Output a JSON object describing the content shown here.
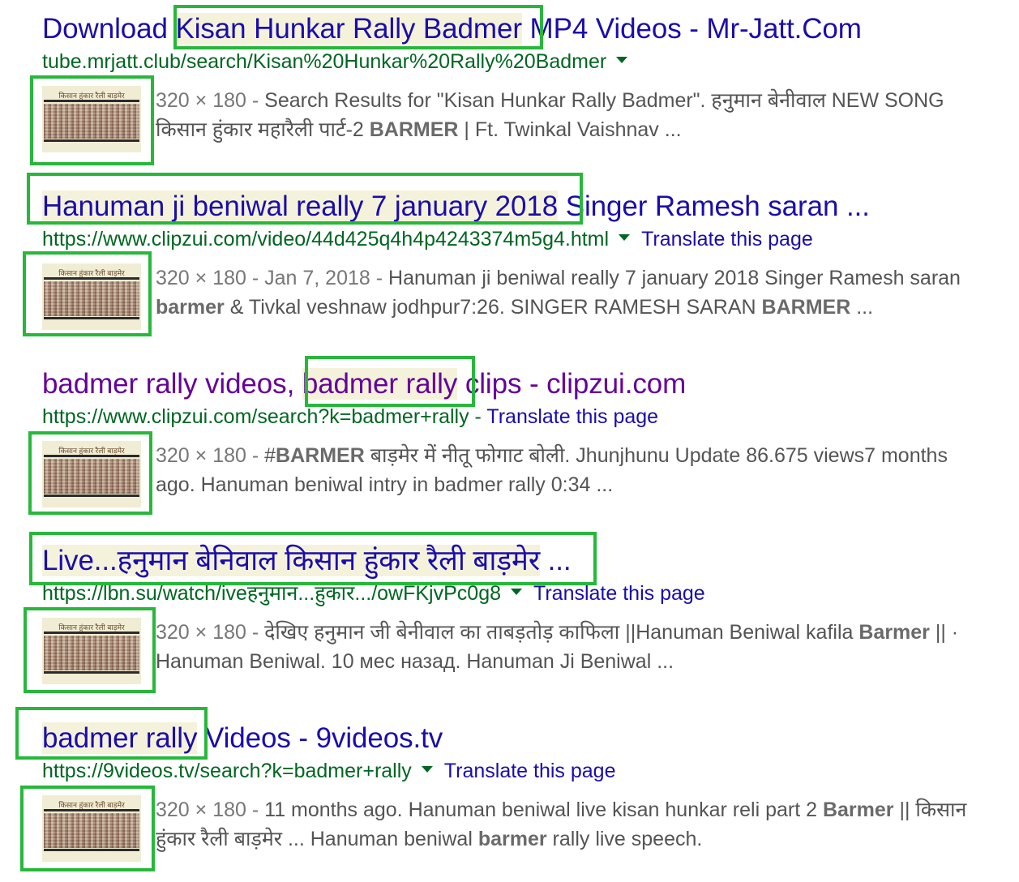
{
  "results": [
    {
      "title_pre": "Download ",
      "title_hl": "Kisan Hunkar Rally Badmer",
      "title_post": " MP4 Videos - Mr-Jatt.Com",
      "url": "tube.mrjatt.club/search/Kisan%20Hunkar%20Rally%20Badmer",
      "translate": "",
      "thumb_caption": "किसान हुंकार रैली बाड़मेर",
      "meta": "320 × 180 - ",
      "s1": "Search Results for \"Kisan Hunkar Rally Badmer\". हनुमान बेनीवाल NEW SONG",
      "s2a": "किसान हुंकार महारैली पार्ट-2 ",
      "s2b": "BARMER",
      "s2c": " | Ft. Twinkal Vaishnav ..."
    },
    {
      "title_pre": "",
      "title_hl": "Hanuman ji beniwal really 7 january 2018",
      "title_post": " Singer Ramesh saran ...",
      "url": "https://www.clipzui.com/video/44d425q4h4p4243374m5g4.html",
      "translate": "Translate this page",
      "thumb_caption": "किसान हुंकार रैली बाड़मेर",
      "meta": "320 × 180 - Jan 7, 2018 - ",
      "s1": "Hanuman ji beniwal really 7 january 2018 Singer Ramesh saran",
      "s2a": "barmer",
      "s2b": " & Tivkal veshnaw jodhpur7:26. SINGER RAMESH SARAN ",
      "s2c": "BARMER",
      "s2d": " ..."
    },
    {
      "title_pre": "badmer rally videos, ",
      "title_hl": "badmer rally",
      "title_post": " clips - clipzui.com",
      "url": "https://www.clipzui.com/search?k=badmer+rally",
      "sep": " - ",
      "translate": "Translate this page",
      "thumb_caption": "किसान हुंकार रैली बाड़मेर",
      "meta": "320 × 180 - ",
      "s1a": "#",
      "s1b": "BARMER",
      "s1c": " बाड़मेर में नीतू फोगाट बोली. Jhunjhunu Update 86.675 views7 months",
      "s2": "ago. Hanuman beniwal intry in badmer rally 0:34 ..."
    },
    {
      "title_pre": "",
      "title_hl": "Live...हनुमान बेनिवाल किसान हुंकार रैली बाड़मेर",
      "title_post": " ...",
      "url": "https://lbn.su/watch/iveहनुमान...हुंकार.../owFKjvPc0g8",
      "translate": "Translate this page",
      "thumb_caption": "किसान हुंकार रैली बाड़मेर",
      "meta": "320 × 180 - ",
      "s1a": "देखिए हनुमान जी बेनीवाल का ताबड़तोड़ काफिला ||Hanuman Beniwal kafila ",
      "s1b": "Barmer",
      "s1c": " || ·",
      "s2": "Hanuman Beniwal. 10 мес назад. Hanuman Ji Beniwal ..."
    },
    {
      "title_pre": "",
      "title_hl": "badmer rally",
      "title_post": " Videos - 9videos.tv",
      "url": "https://9videos.tv/search?k=badmer+rally",
      "translate": "Translate this page",
      "thumb_caption": "किसान हुंकार रैली बाड़मेर",
      "meta": "320 × 180 - ",
      "s1a": "11 months ago. Hanuman beniwal live kisan hunkar reli part 2 ",
      "s1b": "Barmer",
      "s1c": " || किसान",
      "s2a": "हुंकार रैली बाड़मेर ... Hanuman beniwal ",
      "s2b": "barmer",
      "s2c": " rally live speech."
    }
  ],
  "colors": {
    "link": "#1a0dab",
    "visited": "#660099",
    "url": "#006621",
    "snippet": "#545454",
    "annotation_box": "#27b83a"
  }
}
